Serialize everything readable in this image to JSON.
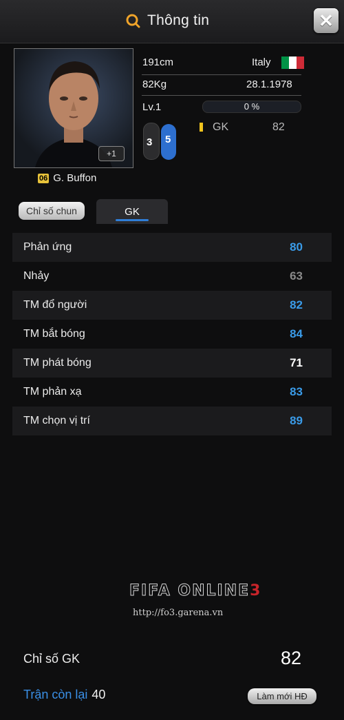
{
  "window": {
    "title": "Thông tin",
    "title_icon": "search-icon",
    "close_icon": "close-icon",
    "close_label": "✕"
  },
  "player": {
    "name": "G. Buffon",
    "season_badge": "06",
    "plus_badge": "+1",
    "height": "191cm",
    "weight": "82Kg",
    "nationality": "Italy",
    "birthdate": "28.1.1978",
    "level": "Lv.1",
    "level_progress": "0 %",
    "level_progress_value": 0,
    "left_foot": "3",
    "right_foot": "5",
    "position": "GK",
    "position_rating": "82",
    "flag_colors": [
      "#009246",
      "#ffffff",
      "#ce2b37"
    ]
  },
  "tabs": {
    "basic": "Chỉ số chun",
    "gk": "GK"
  },
  "attributes": [
    {
      "name": "Phản ứng",
      "value": "80",
      "color": "#3a9be8"
    },
    {
      "name": "Nhảy",
      "value": "63",
      "color": "#8a8a8a"
    },
    {
      "name": "TM đổ người",
      "value": "82",
      "color": "#3a9be8"
    },
    {
      "name": "TM bắt bóng",
      "value": "84",
      "color": "#3a9be8"
    },
    {
      "name": "TM phát bóng",
      "value": "71",
      "color": "#ffffff"
    },
    {
      "name": "TM phản xạ",
      "value": "83",
      "color": "#3a9be8"
    },
    {
      "name": "TM chọn vị trí",
      "value": "89",
      "color": "#3a9be8"
    }
  ],
  "branding": {
    "logo_main": "FIFA ONLINE",
    "logo_num": "3",
    "url": "http://fo3.garena.vn"
  },
  "summary": {
    "label": "Chỉ số GK",
    "value": "82"
  },
  "remaining": {
    "label": "Trận còn lại",
    "value": "40"
  },
  "refresh_button": "Làm mới HĐ"
}
